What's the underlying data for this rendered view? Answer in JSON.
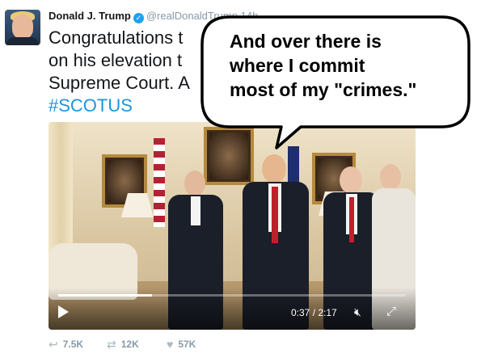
{
  "tweet": {
    "author": {
      "name": "Donald J. Trump",
      "handle": "@realDonaldTrump",
      "time": "14h"
    },
    "text_lines": [
      "Congratulations t",
      "on his elevation t",
      "Supreme Court. A"
    ],
    "hashtag": "#SCOTUS"
  },
  "video": {
    "elapsed": "0:37",
    "separator": " / ",
    "duration": "2:17",
    "progress": 0.27,
    "icons": {
      "play": "play-icon",
      "mute": "mute-icon",
      "fullscreen": "fullscreen-icon"
    }
  },
  "actions": {
    "reply": {
      "icon": "reply-icon",
      "count": "7.5K"
    },
    "retweet": {
      "icon": "retweet-icon",
      "count": "12K"
    },
    "like": {
      "icon": "heart-icon",
      "count": "57K"
    }
  },
  "speech_bubble": {
    "lines": [
      "And over there is",
      "where I commit",
      "most of my \"crimes.\""
    ]
  },
  "colors": {
    "link": "#1b95e0",
    "verified": "#1da1f2",
    "muted": "#8899a6"
  }
}
